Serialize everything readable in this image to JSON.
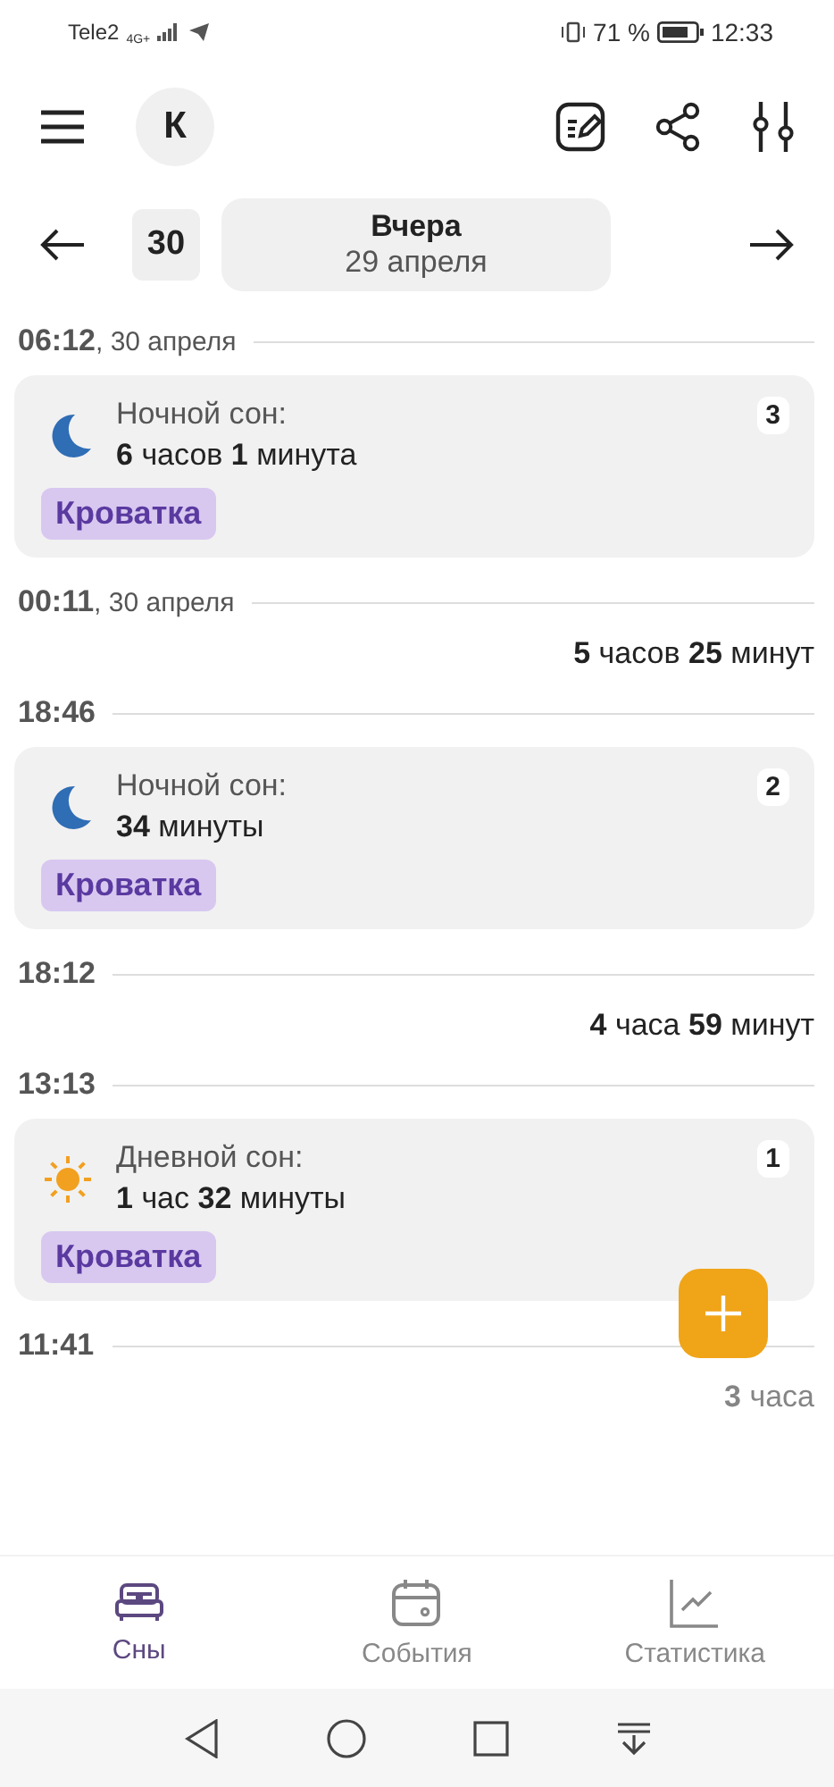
{
  "status_bar": {
    "carrier": "Tele2",
    "network": "4G+",
    "battery": "71 %",
    "time": "12:33"
  },
  "header": {
    "avatar": "К"
  },
  "date_nav": {
    "day": "30",
    "title": "Вчера",
    "date": "29 апреля"
  },
  "timeline": [
    {
      "kind": "time",
      "time": "06:12",
      "date": ", 30 апреля"
    },
    {
      "kind": "night_sleep",
      "title": "Ночной сон:",
      "duration": "**6** часов **1** минута",
      "tag": "Кроватка",
      "number": "3"
    },
    {
      "kind": "time",
      "time": "00:11",
      "date": ", 30 апреля"
    },
    {
      "kind": "gap",
      "duration": "**5** часов **25** минут"
    },
    {
      "kind": "time",
      "time": "18:46"
    },
    {
      "kind": "night_sleep",
      "title": "Ночной сон:",
      "duration": "**34** минуты",
      "tag": "Кроватка",
      "number": "2"
    },
    {
      "kind": "time",
      "time": "18:12"
    },
    {
      "kind": "gap",
      "duration": "**4** часа **59** минут"
    },
    {
      "kind": "time",
      "time": "13:13"
    },
    {
      "kind": "day_sleep",
      "title": "Дневной сон:",
      "duration": "**1** час **32** минуты",
      "tag": "Кроватка",
      "number": "1"
    },
    {
      "kind": "time",
      "time": "11:41"
    },
    {
      "kind": "gap",
      "duration": "**3** часа",
      "faded": true
    }
  ],
  "bottom_nav": [
    {
      "label": "Сны",
      "selected": true
    },
    {
      "label": "События",
      "selected": false
    },
    {
      "label": "Статистика",
      "selected": false
    }
  ]
}
